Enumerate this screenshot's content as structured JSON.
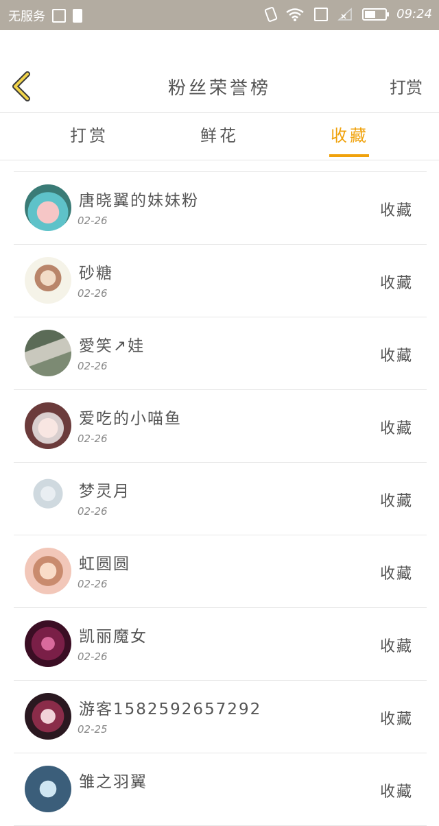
{
  "status_bar": {
    "carrier": "无服务",
    "time": "09:24",
    "battery_level_percent": 55,
    "icons": [
      "image-icon",
      "sd-card-icon",
      "vibrate-icon",
      "wifi-icon",
      "phone-icon",
      "signal-icon",
      "battery-icon"
    ]
  },
  "header": {
    "back_icon": "chevron-left-icon",
    "title": "粉丝荣誉榜",
    "action_label": "打赏",
    "accent_color": "#f0a20c"
  },
  "tabs": [
    {
      "label": "打赏",
      "active": false
    },
    {
      "label": "鲜花",
      "active": false
    },
    {
      "label": "收藏",
      "active": true
    }
  ],
  "list": [
    {
      "name": "唐晓翼的妹妹粉",
      "date": "02-26",
      "action": "收藏"
    },
    {
      "name": "砂糖",
      "date": "02-26",
      "action": "收藏"
    },
    {
      "name": "愛笑↗娃",
      "date": "02-26",
      "action": "收藏"
    },
    {
      "name": "爱吃的小喵鱼",
      "date": "02-26",
      "action": "收藏"
    },
    {
      "name": "梦灵月",
      "date": "02-26",
      "action": "收藏"
    },
    {
      "name": "虹圆圆",
      "date": "02-26",
      "action": "收藏"
    },
    {
      "name": "凯丽魔女",
      "date": "02-26",
      "action": "收藏"
    },
    {
      "name": "游客1582592657292",
      "date": "02-25",
      "action": "收藏"
    },
    {
      "name": "雏之羽翼",
      "date": "",
      "action": "收藏"
    }
  ]
}
